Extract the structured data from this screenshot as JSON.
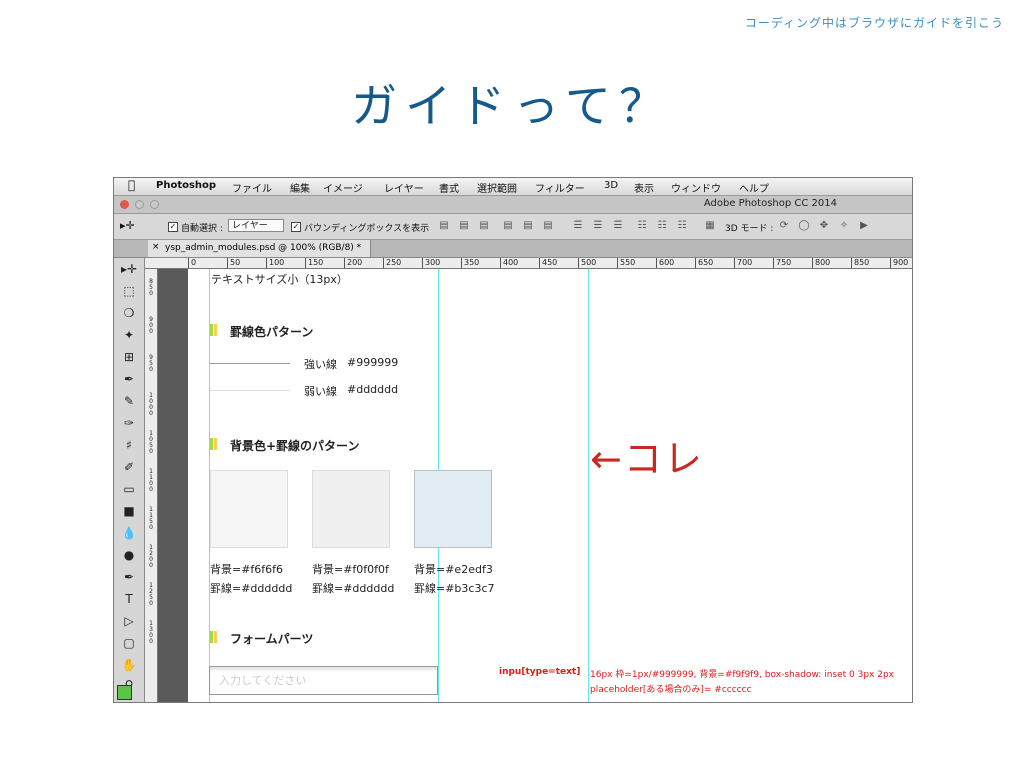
{
  "slide": {
    "subtitle": "コーディング中はブラウザにガイドを引こう",
    "title": "ガイドって？"
  },
  "menubar": {
    "app": "Photoshop",
    "items": [
      "ファイル",
      "編集",
      "イメージ",
      "レイヤー",
      "書式",
      "選択範囲",
      "フィルター",
      "3D",
      "表示",
      "ウィンドウ",
      "ヘルプ"
    ]
  },
  "window": {
    "title": "Adobe Photoshop CC 2014"
  },
  "options_bar": {
    "auto_select_label": "自動選択 :",
    "auto_select_value": "レイヤー",
    "bounding_box_label": "バウンディングボックスを表示",
    "mode_3d_label": "3D モード :"
  },
  "document_tab": {
    "name": "ysp_admin_modules.psd @ 100% (RGB/8) *"
  },
  "ruler": {
    "labels": [
      "0",
      "50",
      "100",
      "150",
      "200",
      "250",
      "300",
      "350",
      "400",
      "450",
      "500",
      "550",
      "600",
      "650",
      "700",
      "750",
      "800",
      "850",
      "900"
    ]
  },
  "vruler": [
    "850",
    "900",
    "950",
    "1000",
    "1050",
    "1100",
    "1150",
    "1200",
    "1250",
    "1300"
  ],
  "canvas": {
    "text_small": "テキストサイズ小（13px）",
    "border_heading": "罫線色パターン",
    "strong_line_label": "強い線",
    "strong_line_value": "#999999",
    "weak_line_label": "弱い線",
    "weak_line_value": "#dddddd",
    "bg_heading": "背景色+罫線のパターン",
    "swatches": [
      {
        "bg_label": "背景=#f6f6f6",
        "border_label": "罫線=#dddddd",
        "bg": "#f6f6f6",
        "border": "#dddddd"
      },
      {
        "bg_label": "背景=#f0f0f0f",
        "border_label": "罫線=#dddddd",
        "bg": "#f0f0f0",
        "border": "#dddddd"
      },
      {
        "bg_label": "背景=#e2edf3",
        "border_label": "罫線=#b3c3c7",
        "bg": "#e2edf3",
        "border": "#b3c3c7"
      }
    ],
    "form_heading": "フォームパーツ",
    "input_placeholder": "入力してください",
    "note_selector": "inpu[type=text]",
    "note_spec_line1": "16px 枠=1px/#999999, 背景=#f9f9f9, box-shadow: inset 0 3px 2px",
    "note_spec_line2": "placeholder[ある場合のみ]= #cccccc"
  },
  "annotation": {
    "text": "←コレ"
  },
  "colors": {
    "title": "#155a8a",
    "subtitle": "#3a8fc4",
    "guide": "#62e7f2",
    "annotation": "#c8281f",
    "note": "#e01a1a",
    "marker_green": "#a8d84a",
    "marker_yellow": "#f2d34a"
  }
}
